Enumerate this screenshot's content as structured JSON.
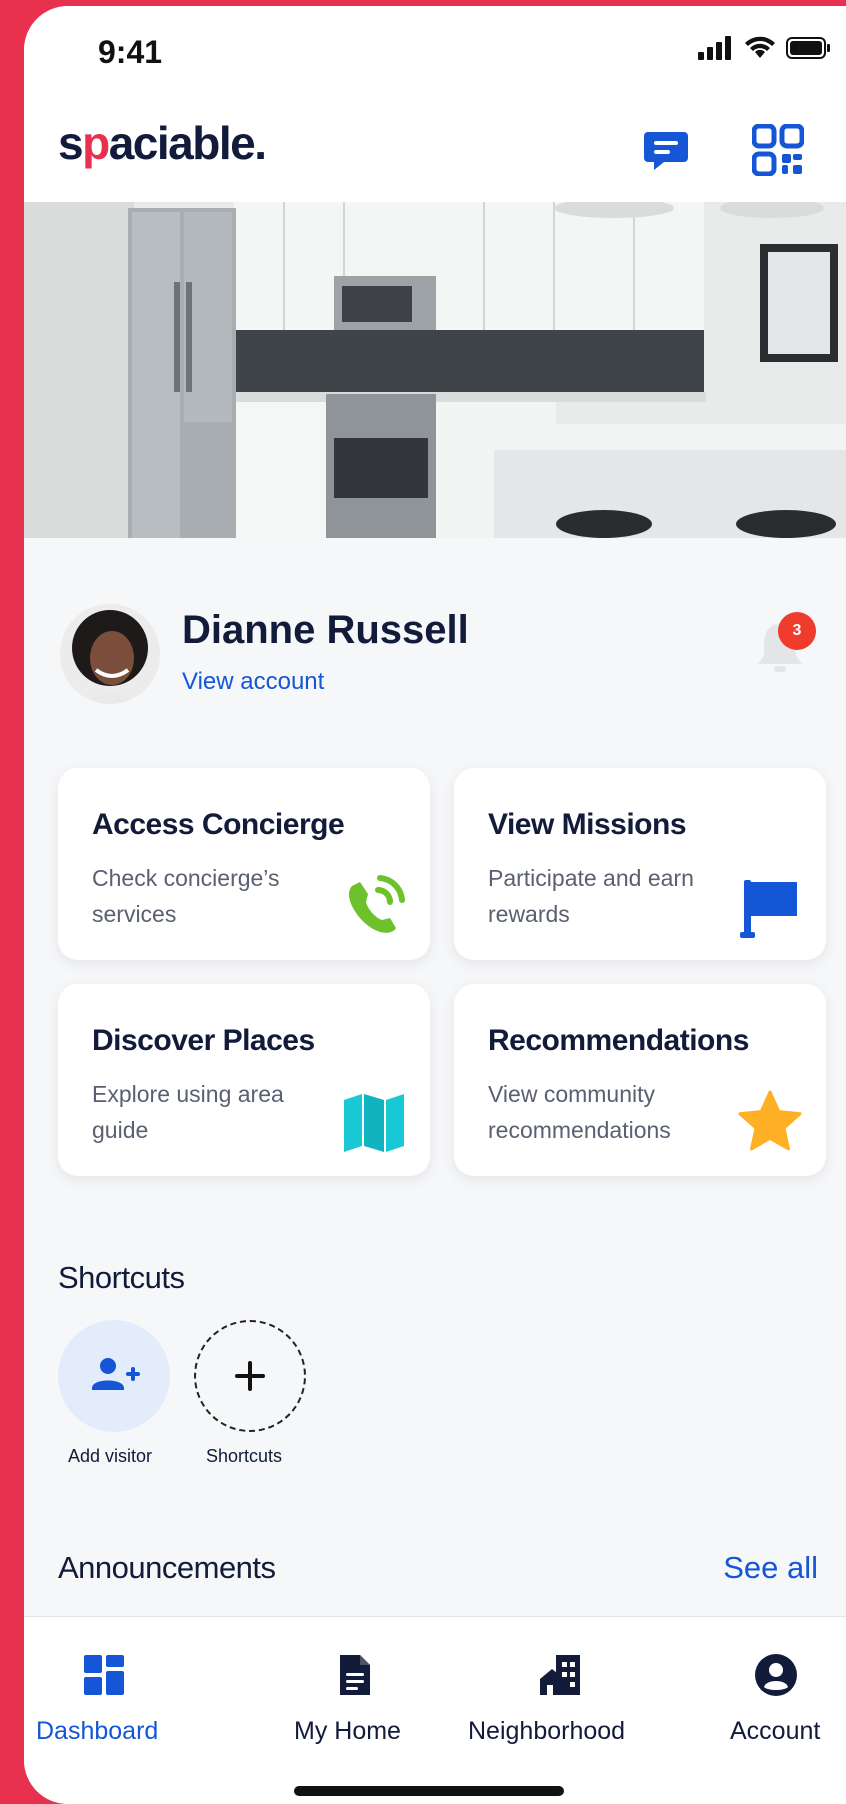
{
  "status_bar": {
    "time": "9:41"
  },
  "app": {
    "logo": "spaciable."
  },
  "profile": {
    "name": "Dianne Russell",
    "link": "View account",
    "notification_count": "3"
  },
  "cards": [
    {
      "title": "Access Concierge",
      "desc": "Check concierge’s services",
      "icon": "phone-call-icon",
      "color": "#6dc22c"
    },
    {
      "title": "View Missions",
      "desc": "Participate and earn rewards",
      "icon": "flag-icon",
      "color": "#1456d6"
    },
    {
      "title": "Discover Places",
      "desc": "Explore using area guide",
      "icon": "map-icon",
      "color": "#18c8d4"
    },
    {
      "title": "Recommendations",
      "desc": "View community recommendations",
      "icon": "star-icon",
      "color": "#ffb024"
    }
  ],
  "shortcuts": {
    "title": "Shortcuts",
    "items": [
      {
        "label": "Add visitor",
        "icon": "add-user-icon"
      },
      {
        "label": "Shortcuts",
        "icon": "plus-icon"
      }
    ]
  },
  "announcements": {
    "title": "Announcements",
    "see_all": "See all"
  },
  "nav": [
    {
      "label": "Dashboard",
      "icon": "dashboard-icon",
      "active": true
    },
    {
      "label": "My Home",
      "icon": "document-icon",
      "active": false
    },
    {
      "label": "Neighborhood",
      "icon": "building-icon",
      "active": false
    },
    {
      "label": "Account",
      "icon": "account-icon",
      "active": false
    }
  ],
  "colors": {
    "accent": "#1456d6",
    "brand": "#e8304f",
    "text": "#121b3a"
  }
}
